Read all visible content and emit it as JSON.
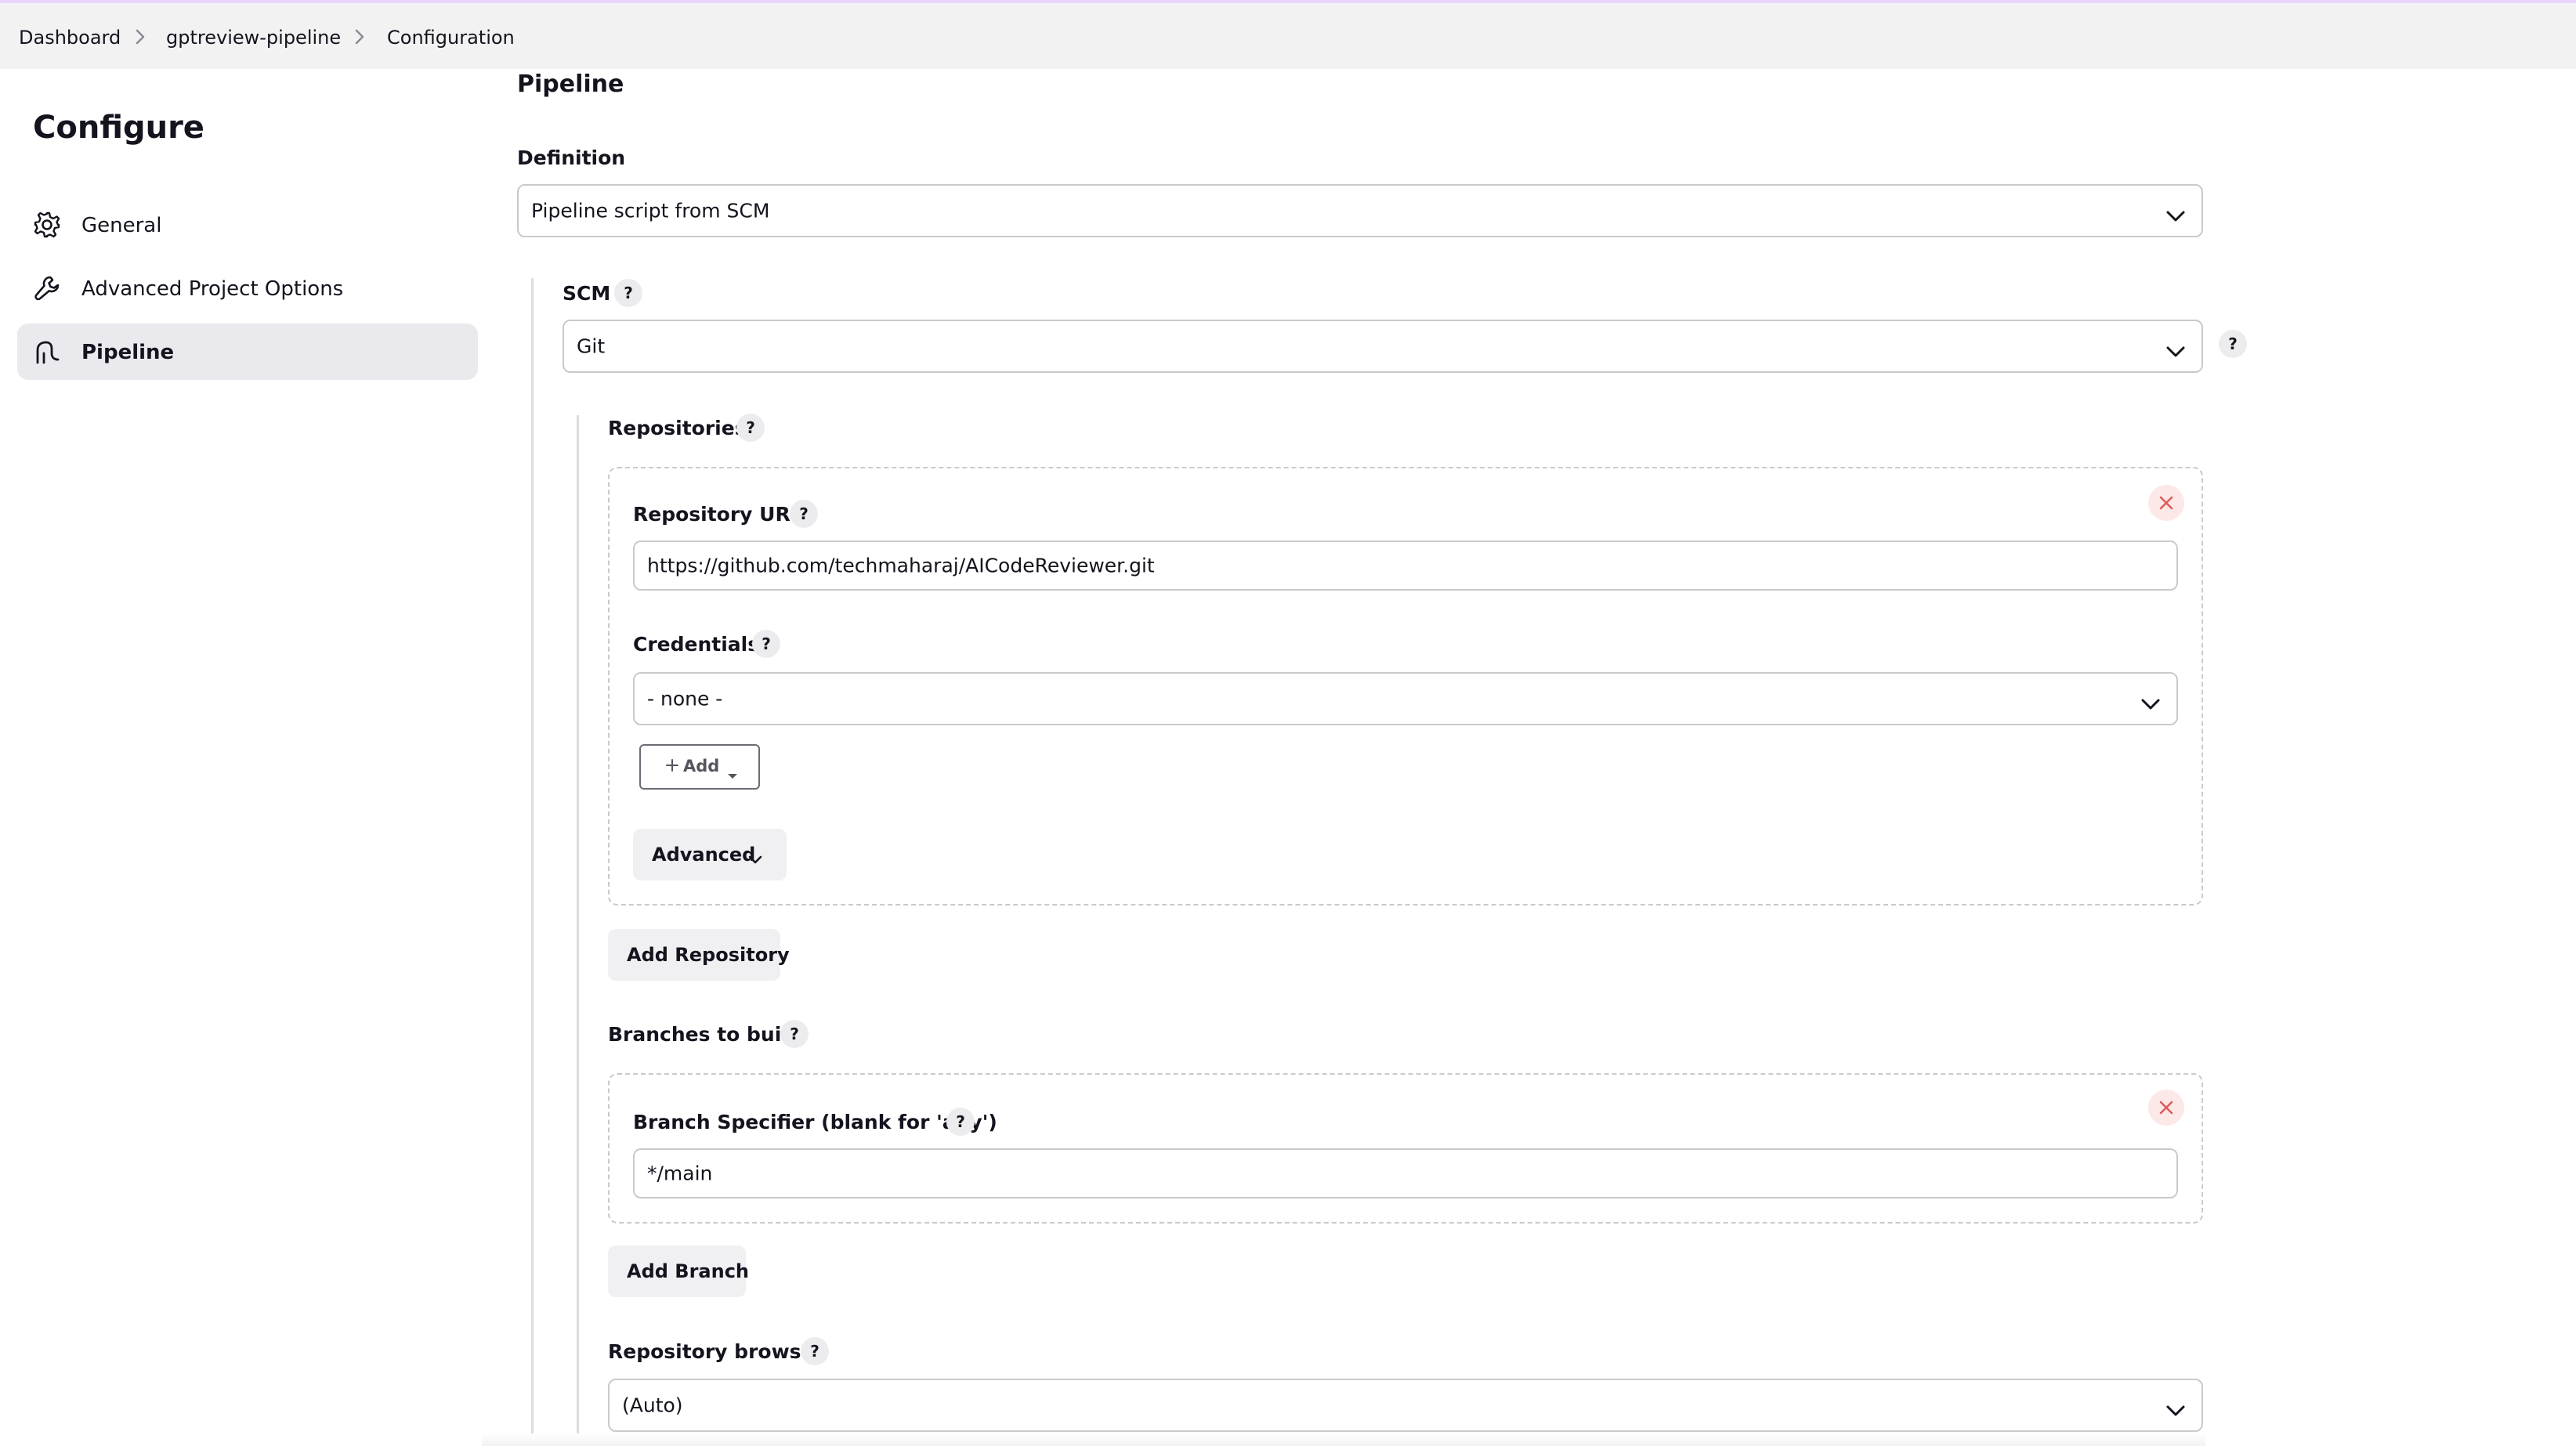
{
  "breadcrumb": {
    "items": [
      "Dashboard",
      "gptreview-pipeline",
      "Configuration"
    ]
  },
  "sidebar": {
    "title": "Configure",
    "items": [
      {
        "label": "General",
        "icon": "gear-icon"
      },
      {
        "label": "Advanced Project Options",
        "icon": "wrench-icon"
      },
      {
        "label": "Pipeline",
        "icon": "pipeline-icon",
        "active": true
      }
    ]
  },
  "main": {
    "section_title": "Pipeline",
    "definition": {
      "label": "Definition",
      "value": "Pipeline script from SCM"
    },
    "scm": {
      "label": "SCM",
      "help": "?",
      "value": "Git",
      "side_help": "?"
    },
    "repositories": {
      "label": "Repositories",
      "help": "?",
      "repository_url": {
        "label": "Repository URL",
        "help": "?",
        "value": "https://github.com/techmaharaj/AICodeReviewer.git"
      },
      "credentials": {
        "label": "Credentials",
        "help": "?",
        "value": "- none -"
      },
      "add_button": "Add",
      "advanced_button": "Advanced",
      "add_repository_button": "Add Repository"
    },
    "branches": {
      "label": "Branches to build",
      "help": "?",
      "branch_specifier": {
        "label": "Branch Specifier (blank for 'any')",
        "help": "?",
        "value": "*/main"
      },
      "add_branch_button": "Add Branch"
    },
    "repository_browser": {
      "label": "Repository browser",
      "help": "?",
      "value": "(Auto)"
    }
  },
  "colors": {
    "page_bg": "#ffffff",
    "breadcrumb_bg": "#f2f2f3",
    "active_item_bg": "#e9e9ee",
    "border": "#c9c9ce",
    "close_bg": "#fde8e8",
    "close_icon": "#e05a5a"
  }
}
